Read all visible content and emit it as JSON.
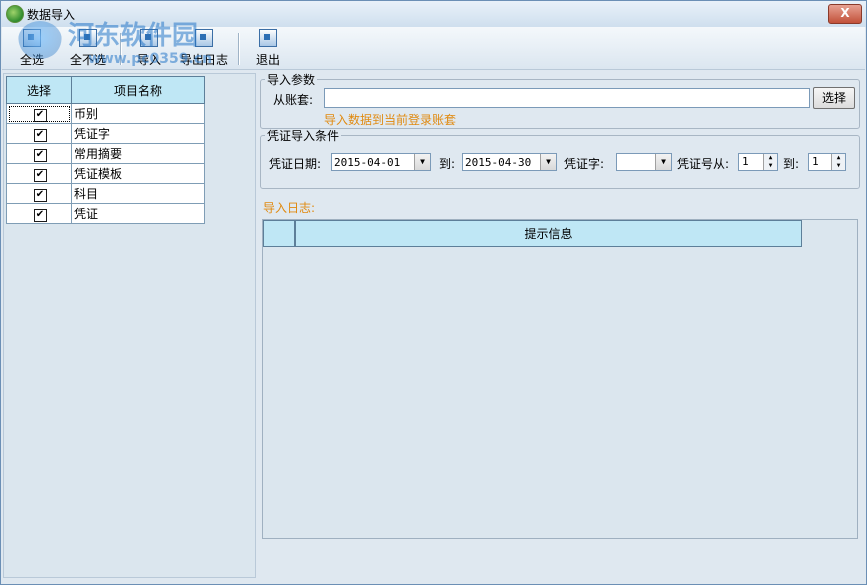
{
  "window": {
    "title": "数据导入",
    "close_label": "X"
  },
  "watermark": {
    "line1": "河东软件园",
    "line2": "www.pc0359.cn"
  },
  "toolbar": {
    "select_all": "全选",
    "deselect_all": "全不选",
    "import": "导入",
    "export_log": "导出日志",
    "exit": "退出"
  },
  "items_table": {
    "headers": {
      "select": "选择",
      "name": "项目名称"
    },
    "rows": [
      {
        "name": "币别",
        "checked": "✔"
      },
      {
        "name": "凭证字",
        "checked": "✔"
      },
      {
        "name": "常用摘要",
        "checked": "✔"
      },
      {
        "name": "凭证模板",
        "checked": "✔"
      },
      {
        "name": "科目",
        "checked": "✔"
      },
      {
        "name": "凭证",
        "checked": "✔"
      }
    ]
  },
  "import_params": {
    "legend": "导入参数",
    "account_label": "从账套:",
    "account_value": "",
    "select_button": "选择",
    "hint": "导入数据到当前登录账套"
  },
  "voucher_conditions": {
    "legend": "凭证导入条件",
    "date_label": "凭证日期:",
    "date_from": "2015-04-01",
    "to_label": "到:",
    "date_to": "2015-04-30",
    "word_label": "凭证字:",
    "word_value": "",
    "number_from_label": "凭证号从:",
    "number_from": "1",
    "number_to_label": "到:",
    "number_to": "1"
  },
  "log": {
    "label": "导入日志:",
    "column_header": "提示信息"
  }
}
